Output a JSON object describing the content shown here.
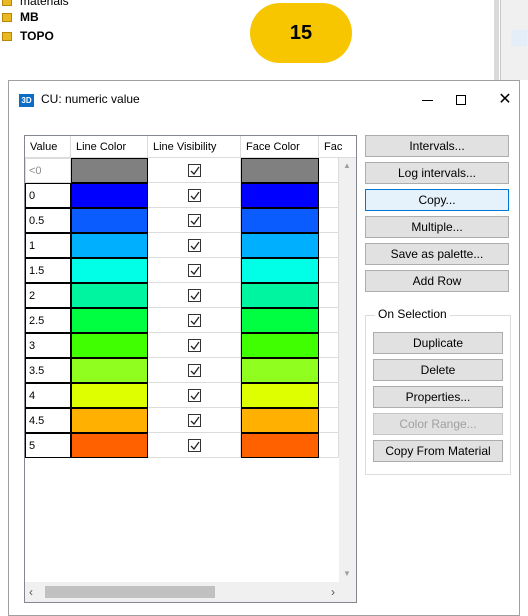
{
  "background": {
    "tree_items": [
      {
        "label": "materials"
      },
      {
        "label": "MB"
      },
      {
        "label": "TOPO"
      }
    ],
    "badge": "15"
  },
  "dialog": {
    "icon_text": "3D",
    "title": "CU: numeric value",
    "columns": [
      "Value",
      "Line Color",
      "Line Visibility",
      "Face Color",
      "Fac"
    ],
    "rows": [
      {
        "value": "<0",
        "line_color": "#808080",
        "visible": true,
        "face_color": "#808080"
      },
      {
        "value": "0",
        "line_color": "#0000ff",
        "visible": true,
        "face_color": "#0000ff"
      },
      {
        "value": "0.5",
        "line_color": "#0a5cff",
        "visible": true,
        "face_color": "#0a5cff"
      },
      {
        "value": "1",
        "line_color": "#00b0ff",
        "visible": true,
        "face_color": "#00b0ff"
      },
      {
        "value": "1.5",
        "line_color": "#00ffe6",
        "visible": true,
        "face_color": "#00ffe6"
      },
      {
        "value": "2",
        "line_color": "#00f5a0",
        "visible": true,
        "face_color": "#00f5a0"
      },
      {
        "value": "2.5",
        "line_color": "#00ff40",
        "visible": true,
        "face_color": "#00ff40"
      },
      {
        "value": "3",
        "line_color": "#40ff00",
        "visible": true,
        "face_color": "#40ff00"
      },
      {
        "value": "3.5",
        "line_color": "#90ff20",
        "visible": true,
        "face_color": "#90ff20"
      },
      {
        "value": "4",
        "line_color": "#ddff00",
        "visible": true,
        "face_color": "#ddff00"
      },
      {
        "value": "4.5",
        "line_color": "#ffb000",
        "visible": true,
        "face_color": "#ffb000"
      },
      {
        "value": "5",
        "line_color": "#ff6000",
        "visible": true,
        "face_color": "#ff6000"
      }
    ],
    "buttons": {
      "intervals": "Intervals...",
      "log_intervals": "Log intervals...",
      "copy": "Copy...",
      "multiple": "Multiple...",
      "save_palette": "Save as palette...",
      "add_row": "Add Row"
    },
    "selection_group": {
      "label": "On Selection",
      "duplicate": "Duplicate",
      "delete": "Delete",
      "properties": "Properties...",
      "color_range": "Color Range...",
      "copy_from_material": "Copy From Material"
    }
  }
}
